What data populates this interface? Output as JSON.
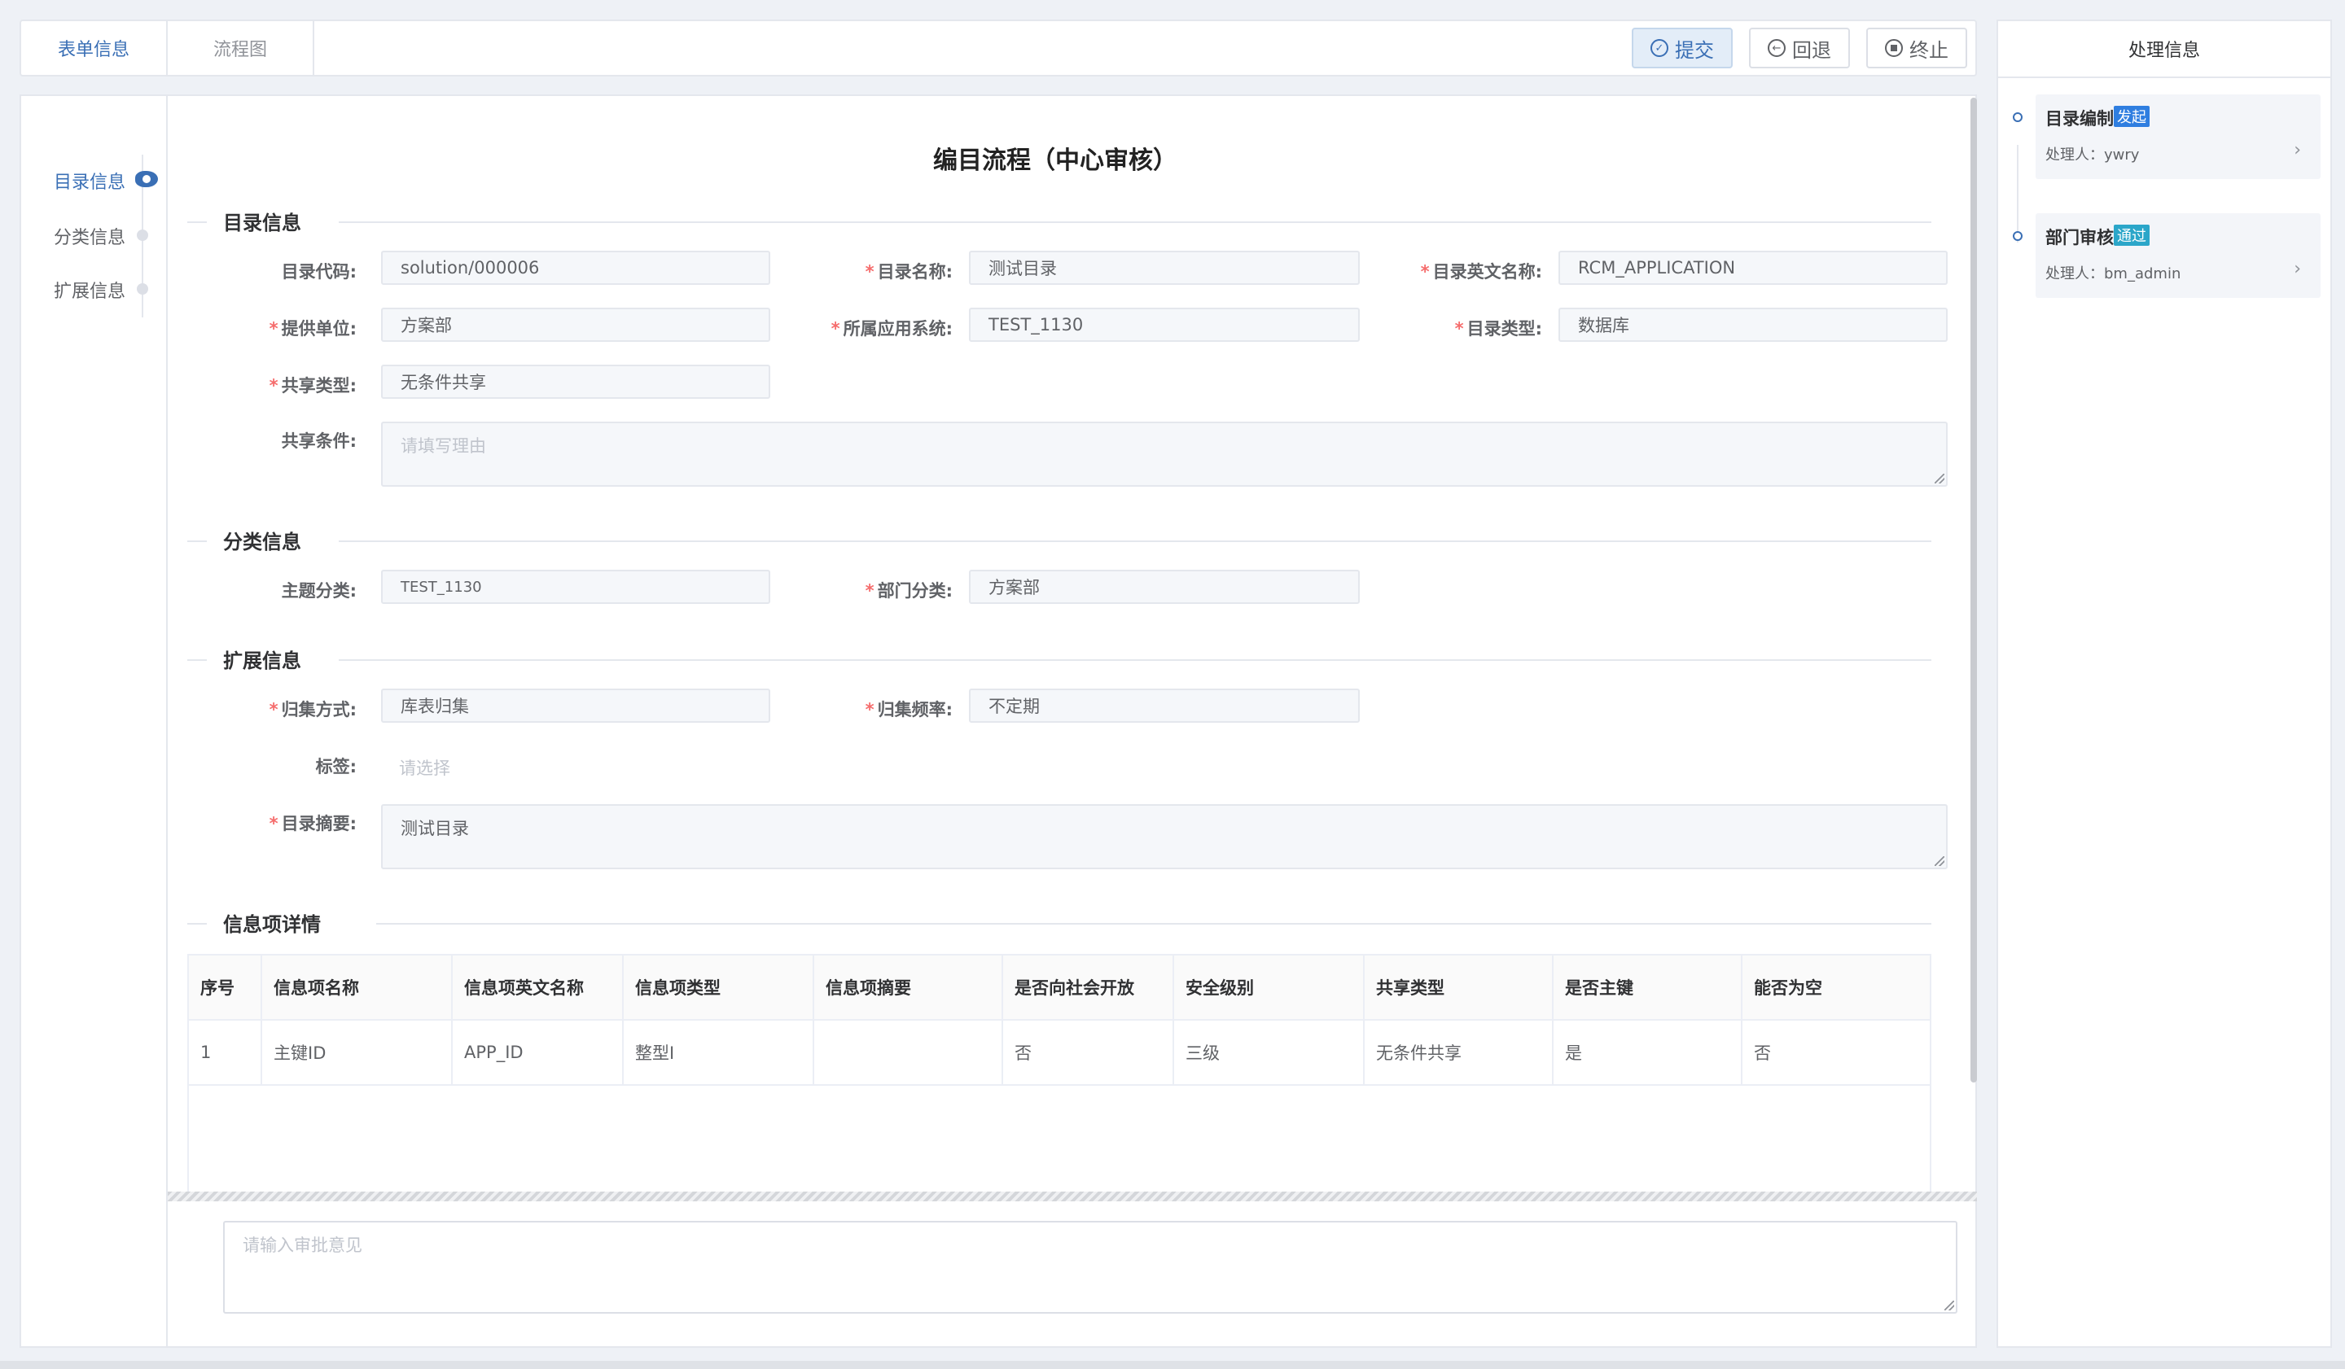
{
  "tabs": {
    "form": "表单信息",
    "flow": "流程图"
  },
  "actions": {
    "submit": "提交",
    "back": "回退",
    "end": "终止"
  },
  "anchors": {
    "catalog": "目录信息",
    "category": "分类信息",
    "extension": "扩展信息"
  },
  "form": {
    "title": "编目流程（中心审核）",
    "required_mark": "*",
    "sections": {
      "catalog": "目录信息",
      "category": "分类信息",
      "extension": "扩展信息",
      "items": "信息项详情"
    },
    "fields": {
      "code": {
        "label": "目录代码:",
        "value": "solution/000006"
      },
      "name": {
        "label": "目录名称:",
        "value": "测试目录"
      },
      "en_name": {
        "label": "目录英文名称:",
        "value": "RCM_APPLICATION"
      },
      "provider": {
        "label": "提供单位:",
        "value": "方案部"
      },
      "app_system": {
        "label": "所属应用系统:",
        "value": "TEST_1130"
      },
      "catalog_type": {
        "label": "目录类型:",
        "value": "数据库"
      },
      "share_type": {
        "label": "共享类型:",
        "value": "无条件共享"
      },
      "share_condition": {
        "label": "共享条件:",
        "placeholder": "请填写理由"
      },
      "subject": {
        "label": "主题分类:",
        "value": "TEST_1130"
      },
      "dept": {
        "label": "部门分类:",
        "value": "方案部"
      },
      "collect_method": {
        "label": "归集方式:",
        "value": "库表归集"
      },
      "collect_freq": {
        "label": "归集频率:",
        "value": "不定期"
      },
      "tags": {
        "label": "标签:",
        "placeholder": "请选择"
      },
      "summary": {
        "label": "目录摘要:",
        "value": "测试目录"
      }
    }
  },
  "table": {
    "headers": [
      "序号",
      "信息项名称",
      "信息项英文名称",
      "信息项类型",
      "信息项摘要",
      "是否向社会开放",
      "安全级别",
      "共享类型",
      "是否主键",
      "能否为空"
    ],
    "rows": [
      [
        "1",
        "主键ID",
        "APP_ID",
        "整型I",
        "",
        "否",
        "三级",
        "无条件共享",
        "是",
        "否"
      ]
    ]
  },
  "opinion": {
    "placeholder": "请输入审批意见"
  },
  "process": {
    "title": "处理信息",
    "nodes": [
      {
        "name": "目录编制",
        "badge": "发起",
        "handler": "处理人：ywry"
      },
      {
        "name": "部门审核",
        "badge": "通过",
        "handler": "处理人：bm_admin"
      }
    ]
  },
  "colors": {
    "accent": "#3a6fb5",
    "required": "#f56c6c",
    "badge_start": "#2f7ee0",
    "badge_pass": "#2ba6c9"
  },
  "icons": {
    "submit": "check-circle-icon",
    "back": "back-circle-icon",
    "end": "stop-circle-icon",
    "chevron": "chevron-right-icon"
  }
}
